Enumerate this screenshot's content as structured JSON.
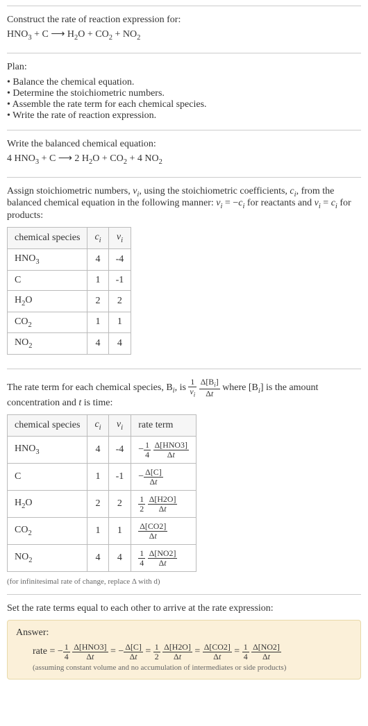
{
  "chart_data": [
    {
      "type": "table",
      "title": "stoichiometric numbers",
      "columns": [
        "chemical species",
        "c_i",
        "ν_i"
      ],
      "rows": [
        [
          "HNO3",
          4,
          -4
        ],
        [
          "C",
          1,
          -1
        ],
        [
          "H2O",
          2,
          2
        ],
        [
          "CO2",
          1,
          1
        ],
        [
          "NO2",
          4,
          4
        ]
      ]
    },
    {
      "type": "table",
      "title": "rate terms",
      "columns": [
        "chemical species",
        "c_i",
        "ν_i",
        "rate term"
      ],
      "rows": [
        [
          "HNO3",
          4,
          -4,
          "-1/4 Δ[HNO3]/Δt"
        ],
        [
          "C",
          1,
          -1,
          "-Δ[C]/Δt"
        ],
        [
          "H2O",
          2,
          2,
          "1/2 Δ[H2O]/Δt"
        ],
        [
          "CO2",
          1,
          1,
          "Δ[CO2]/Δt"
        ],
        [
          "NO2",
          4,
          4,
          "1/4 Δ[NO2]/Δt"
        ]
      ]
    }
  ],
  "intro": {
    "prompt": "Construct the rate of reaction expression for:",
    "equation_html": "HNO<span class='sub'>3</span> + C ⟶ H<span class='sub'>2</span>O + CO<span class='sub'>2</span> + NO<span class='sub'>2</span>"
  },
  "plan": {
    "head": "Plan:",
    "items": [
      "Balance the chemical equation.",
      "Determine the stoichiometric numbers.",
      "Assemble the rate term for each chemical species.",
      "Write the rate of reaction expression."
    ]
  },
  "balanced": {
    "head": "Write the balanced chemical equation:",
    "equation_html": "4 HNO<span class='sub'>3</span> + C ⟶ 2 H<span class='sub'>2</span>O + CO<span class='sub'>2</span> + 4 NO<span class='sub'>2</span>"
  },
  "stoich": {
    "head_html": "Assign stoichiometric numbers, <span class='ital'>ν<span class='sub'>i</span></span>, using the stoichiometric coefficients, <span class='ital'>c<span class='sub'>i</span></span>, from the balanced chemical equation in the following manner: <span class='ital'>ν<span class='sub'>i</span></span> = −<span class='ital'>c<span class='sub'>i</span></span> for reactants and <span class='ital'>ν<span class='sub'>i</span></span> = <span class='ital'>c<span class='sub'>i</span></span> for products:",
    "cols": {
      "species": "chemical species",
      "c": "c",
      "c_sub": "i",
      "nu": "ν",
      "nu_sub": "i"
    },
    "rows": [
      {
        "species_html": "HNO<span class='sub'>3</span>",
        "c": "4",
        "nu": "-4"
      },
      {
        "species_html": "C",
        "c": "1",
        "nu": "-1"
      },
      {
        "species_html": "H<span class='sub'>2</span>O",
        "c": "2",
        "nu": "2"
      },
      {
        "species_html": "CO<span class='sub'>2</span>",
        "c": "1",
        "nu": "1"
      },
      {
        "species_html": "NO<span class='sub'>2</span>",
        "c": "4",
        "nu": "4"
      }
    ]
  },
  "rateterm": {
    "head_pre": "The rate term for each chemical species, B",
    "head_post_html": ", is <span class='frac'><span class='num'>1</span><span class='den'><span class='ital'>ν<span class='sub'>i</span></span></span></span> <span class='frac'><span class='num'>Δ[B<span class='sub ital'>i</span>]</span><span class='den'>Δ<span class='ital'>t</span></span></span> where [B<span class='sub ital'>i</span>] is the amount concentration and <span class='ital'>t</span> is time:",
    "cols": {
      "species": "chemical species",
      "c": "c",
      "c_sub": "i",
      "nu": "ν",
      "nu_sub": "i",
      "rate": "rate term"
    },
    "rows": [
      {
        "species_html": "HNO<span class='sub'>3</span>",
        "c": "4",
        "nu": "-4",
        "rate_html": "−<span class='frac'><span class='num'>1</span><span class='den'>4</span></span> <span class='frac'><span class='num'>Δ[HNO3]</span><span class='den'>Δ<span class='ital'>t</span></span></span>"
      },
      {
        "species_html": "C",
        "c": "1",
        "nu": "-1",
        "rate_html": "−<span class='frac'><span class='num'>Δ[C]</span><span class='den'>Δ<span class='ital'>t</span></span></span>"
      },
      {
        "species_html": "H<span class='sub'>2</span>O",
        "c": "2",
        "nu": "2",
        "rate_html": "<span class='frac'><span class='num'>1</span><span class='den'>2</span></span> <span class='frac'><span class='num'>Δ[H2O]</span><span class='den'>Δ<span class='ital'>t</span></span></span>"
      },
      {
        "species_html": "CO<span class='sub'>2</span>",
        "c": "1",
        "nu": "1",
        "rate_html": "<span class='frac'><span class='num'>Δ[CO2]</span><span class='den'>Δ<span class='ital'>t</span></span></span>"
      },
      {
        "species_html": "NO<span class='sub'>2</span>",
        "c": "4",
        "nu": "4",
        "rate_html": "<span class='frac'><span class='num'>1</span><span class='den'>4</span></span> <span class='frac'><span class='num'>Δ[NO2]</span><span class='den'>Δ<span class='ital'>t</span></span></span>"
      }
    ],
    "note": "(for infinitesimal rate of change, replace Δ with d)"
  },
  "final": {
    "head": "Set the rate terms equal to each other to arrive at the rate expression:",
    "ans_label": "Answer:",
    "rate_html": "rate = −<span class='frac'><span class='num'>1</span><span class='den'>4</span></span> <span class='frac'><span class='num'>Δ[HNO3]</span><span class='den'>Δ<span class='ital'>t</span></span></span> = −<span class='frac'><span class='num'>Δ[C]</span><span class='den'>Δ<span class='ital'>t</span></span></span> = <span class='frac'><span class='num'>1</span><span class='den'>2</span></span> <span class='frac'><span class='num'>Δ[H2O]</span><span class='den'>Δ<span class='ital'>t</span></span></span> = <span class='frac'><span class='num'>Δ[CO2]</span><span class='den'>Δ<span class='ital'>t</span></span></span> = <span class='frac'><span class='num'>1</span><span class='den'>4</span></span> <span class='frac'><span class='num'>Δ[NO2]</span><span class='den'>Δ<span class='ital'>t</span></span></span>",
    "note": "(assuming constant volume and no accumulation of intermediates or side products)"
  }
}
